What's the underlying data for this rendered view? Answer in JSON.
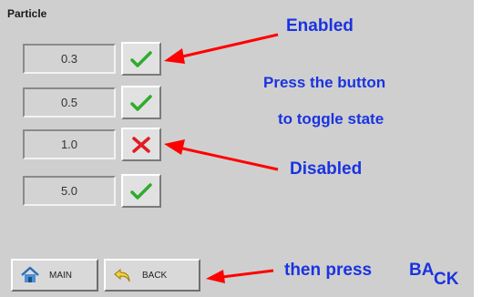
{
  "panel": {
    "title": "Particle"
  },
  "particles": [
    {
      "value": "0.3",
      "state": "enabled",
      "icon": "check-icon"
    },
    {
      "value": "0.5",
      "state": "enabled",
      "icon": "check-icon"
    },
    {
      "value": "1.0",
      "state": "disabled",
      "icon": "cross-icon"
    },
    {
      "value": "5.0",
      "state": "enabled",
      "icon": "check-icon"
    }
  ],
  "nav": {
    "main_label": "MAIN",
    "main_icon": "home-icon",
    "back_label": "BACK",
    "back_icon": "back-arrow-icon"
  },
  "annotations": {
    "enabled": "Enabled",
    "press_line1": "Press the button",
    "press_line2": "to toggle state",
    "disabled": "Disabled",
    "then_press": "then press",
    "back_part1": "BA",
    "back_part2": "CK"
  },
  "colors": {
    "annotation_text": "#1a33e0",
    "arrow": "#ff0000",
    "check": "#2eab2e",
    "cross": "#e01c24",
    "panel_bg": "#cfcfcf"
  }
}
